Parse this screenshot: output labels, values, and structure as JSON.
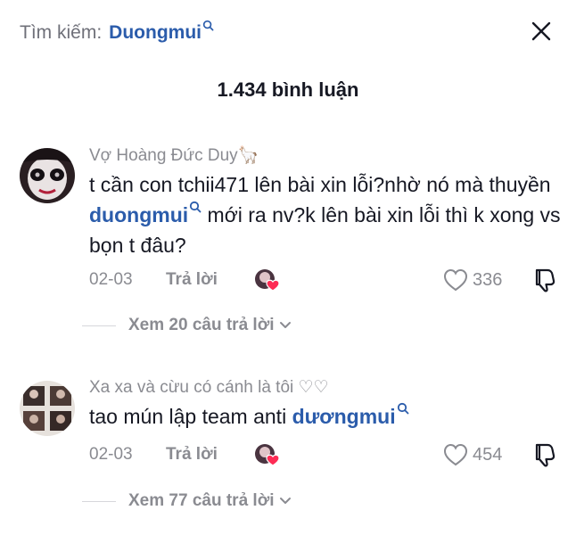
{
  "header": {
    "search_prefix": "Tìm kiếm:",
    "search_term": "Duongmui"
  },
  "comment_count": "1.434 bình luận",
  "comments": [
    {
      "username": "Vợ Hoàng Đức Duy🦙",
      "text_before": "t cần con tchii471 lên bài xin lỗi?nhờ nó mà thuyền ",
      "mention": "duongmui",
      "text_after": " mới ra nv?k lên bài xin lỗi thì k xong vs bọn t đâu?",
      "date": "02-03",
      "reply_label": "Trả lời",
      "likes": "336",
      "view_replies": "Xem 20 câu trả lời"
    },
    {
      "username": "Xa xa và cừu có cánh là tôi ♡♡",
      "text_before": "tao mún lập team anti ",
      "mention": "dươngmui",
      "text_after": "",
      "date": "02-03",
      "reply_label": "Trả lời",
      "likes": "454",
      "view_replies": "Xem 77 câu trả lời"
    }
  ],
  "colors": {
    "mention": "#2b5cab",
    "secondary_text": "#8a8b91",
    "primary_text": "#161823",
    "creator_heart": "#fe2c55"
  }
}
